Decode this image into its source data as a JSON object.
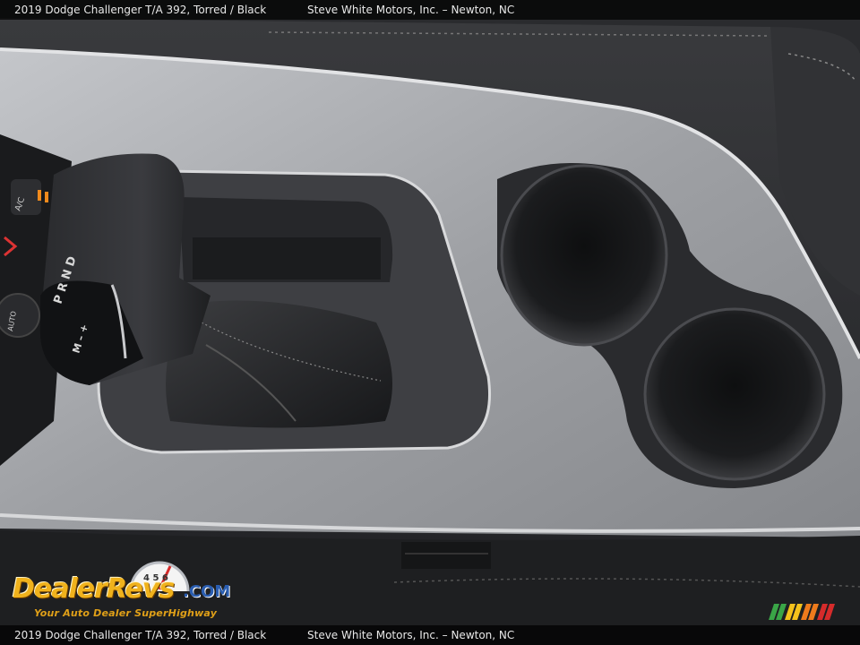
{
  "caption": {
    "vehicle": "2019 Dodge Challenger T/A 392,  Torred / Black",
    "dealer": "Steve White Motors, Inc. – Newton, NC"
  },
  "watermark": {
    "brand": "DealerRevs",
    "tld": ".COM",
    "tagline": "Your Auto Dealer SuperHighway",
    "gauge_digits": "4 5 6"
  },
  "shifter": {
    "gear_letters": "P R N D",
    "manual_letters": "M – +"
  },
  "console_buttons": {
    "ac_label": "A/C",
    "auto_label": "AUTO"
  },
  "colors": {
    "console_trim": "#a7a9ad",
    "cupholder": "#1b1c1e",
    "leather": "#2c2d30",
    "watermark_brand": "#f0b21c",
    "watermark_blue": "#2a5db0",
    "stripe_colors": [
      "#3aa547",
      "#f4c21c",
      "#ef7b1c",
      "#d62b2b"
    ]
  }
}
